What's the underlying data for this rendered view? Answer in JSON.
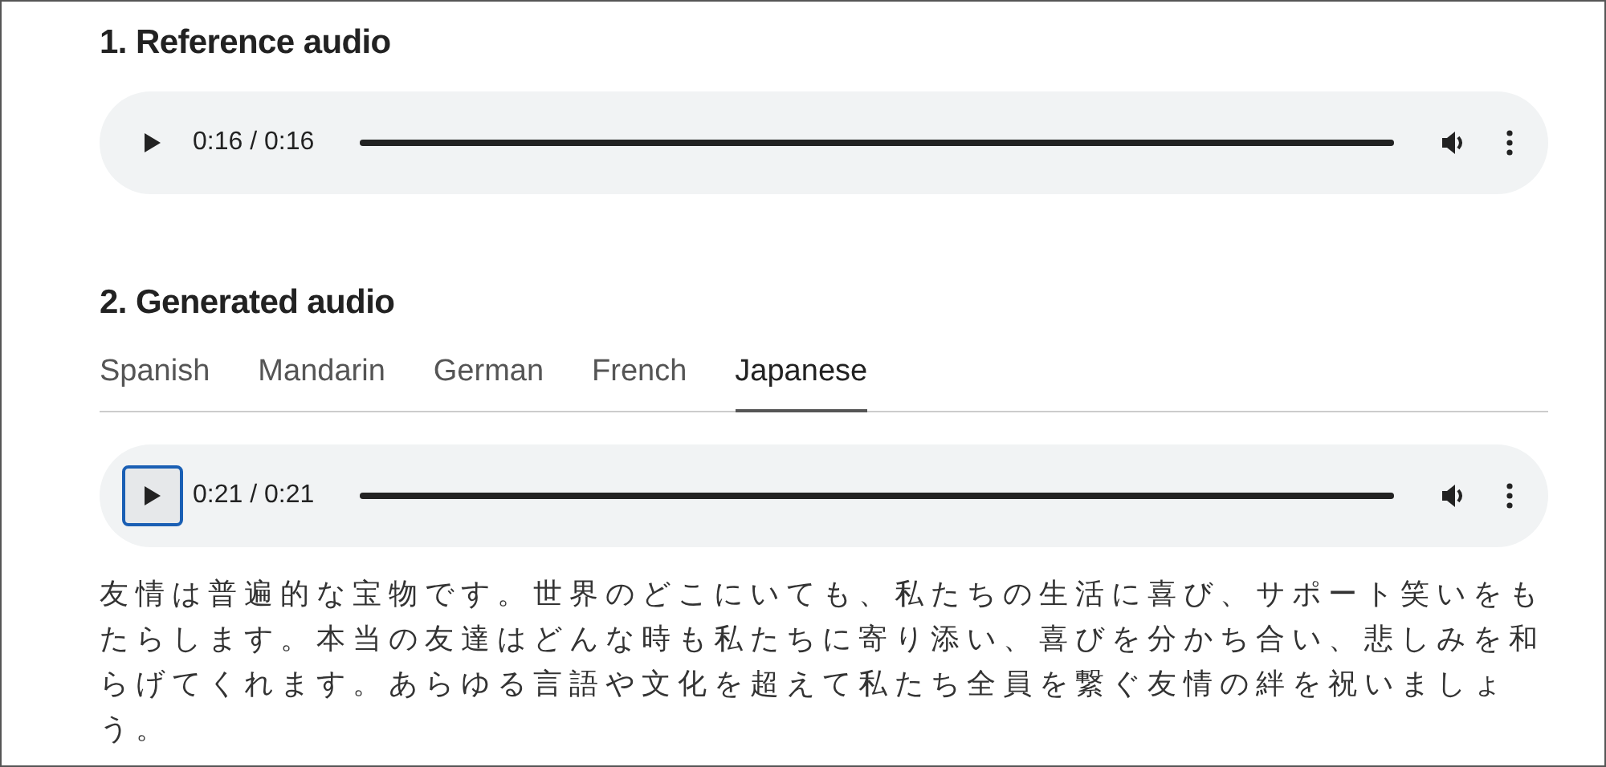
{
  "sections": [
    {
      "kind": "player",
      "heading": "1. Reference audio",
      "player": {
        "time": "0:16 / 0:16",
        "level": 1,
        "focused": false
      }
    },
    {
      "kind": "tabs",
      "heading": "2. Generated audio",
      "tabs": [
        {
          "label": "Spanish",
          "selected": false
        },
        {
          "label": "Mandarin",
          "selected": false
        },
        {
          "label": "German",
          "selected": false
        },
        {
          "label": "French",
          "selected": false
        },
        {
          "label": "Japanese",
          "selected": true
        }
      ],
      "player": {
        "time": "0:21 / 0:21",
        "level": 1,
        "focused": true
      },
      "transcript": "友情は普遍的な宝物です。世界のどこにいても、私たちの生活に喜び、サポート笑いをもたらします。本当の友達はどんな時も私たちに寄り添い、喜びを分かち合い、悲しみを和らげてくれます。あらゆる言語や文化を超えて私たち全員を繋ぐ友情の絆を祝いましょう。"
    }
  ]
}
